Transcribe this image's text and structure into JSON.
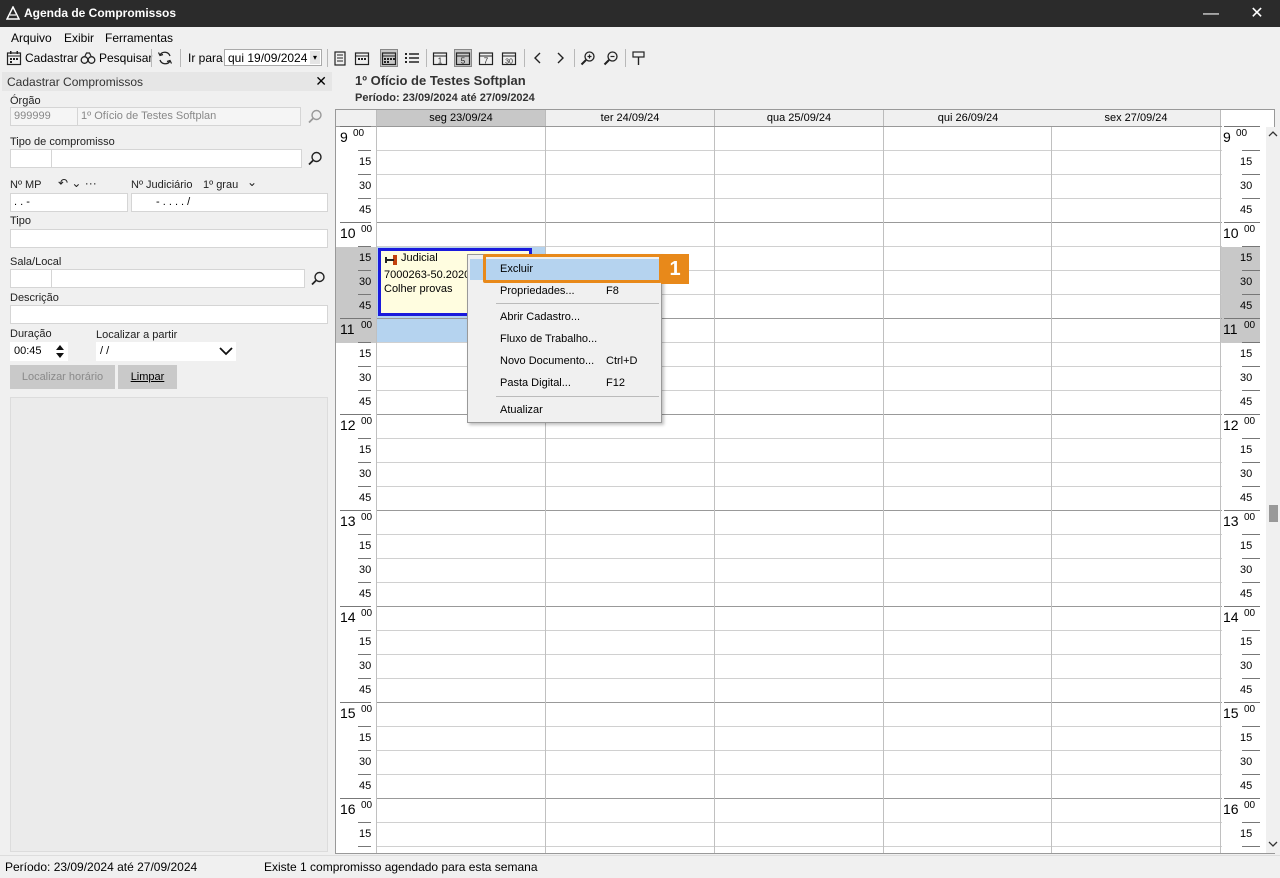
{
  "window": {
    "title": "Agenda de Compromissos",
    "minimize": "—",
    "close": "✕"
  },
  "menu": {
    "items": [
      "Arquivo",
      "Exibir",
      "Ferramentas"
    ]
  },
  "toolbar": {
    "cadastrar": "Cadastrar",
    "pesquisar": "Pesquisar",
    "ir_para": "Ir para",
    "date_value": "qui 19/09/2024",
    "dropdown_glyph": "▾"
  },
  "left_panel": {
    "header": "Cadastrar Compromissos",
    "close_glyph": "✕",
    "orgao_label": "Órgão",
    "orgao_code": "999999",
    "orgao_name": "1º Ofício de Testes Softplan",
    "tipo_compromisso_label": "Tipo de compromisso",
    "nmp_label": "Nº MP",
    "nmp_tools": "↶ ⌄ ···",
    "nmp_mask": ".   .       -",
    "njud_label": "Nº Judiciário",
    "grau_value": "1º grau",
    "grau_chevron": "⌄",
    "njud_mask": "-  .    .  .  .    /",
    "tipo_label": "Tipo",
    "sala_label": "Sala/Local",
    "descricao_label": "Descrição",
    "duracao_label": "Duração",
    "duracao_value": "00:45",
    "localizar_partir_label": "Localizar a partir",
    "localizar_partir_value": " /  /",
    "btn_localizar": "Localizar horário",
    "btn_limpar": "Limpar"
  },
  "calendar": {
    "org_title": "1º Ofício de Testes Softplan",
    "periodo": "Período: 23/09/2024 até 27/09/2024",
    "days": [
      "seg 23/09/24",
      "ter 24/09/24",
      "qua 25/09/24",
      "qui 26/09/24",
      "sex 27/09/24"
    ],
    "hours": [
      "9",
      "10",
      "11",
      "12",
      "13",
      "14",
      "15",
      "16"
    ],
    "hour_minute": "00",
    "quarter_labels": [
      "15",
      "30",
      "45"
    ],
    "appointment": {
      "title": "Judicial",
      "line1": "7000263-50.2020",
      "line2": "Colher provas"
    }
  },
  "context_menu": {
    "items": [
      {
        "label": "Excluir",
        "shortcut": ""
      },
      {
        "label": "Propriedades...",
        "shortcut": "F8"
      },
      {
        "label": "Abrir Cadastro...",
        "shortcut": ""
      },
      {
        "label": "Fluxo de Trabalho...",
        "shortcut": ""
      },
      {
        "label": "Novo Documento...",
        "shortcut": "Ctrl+D"
      },
      {
        "label": "Pasta Digital...",
        "shortcut": "F12"
      },
      {
        "label": "Atualizar",
        "shortcut": ""
      }
    ]
  },
  "callout": {
    "number": "1",
    "color": "#e8891a"
  },
  "statusbar": {
    "periodo": "Período: 23/09/2024 até 27/09/2024",
    "message": "Existe 1 compromisso agendado para esta semana"
  }
}
